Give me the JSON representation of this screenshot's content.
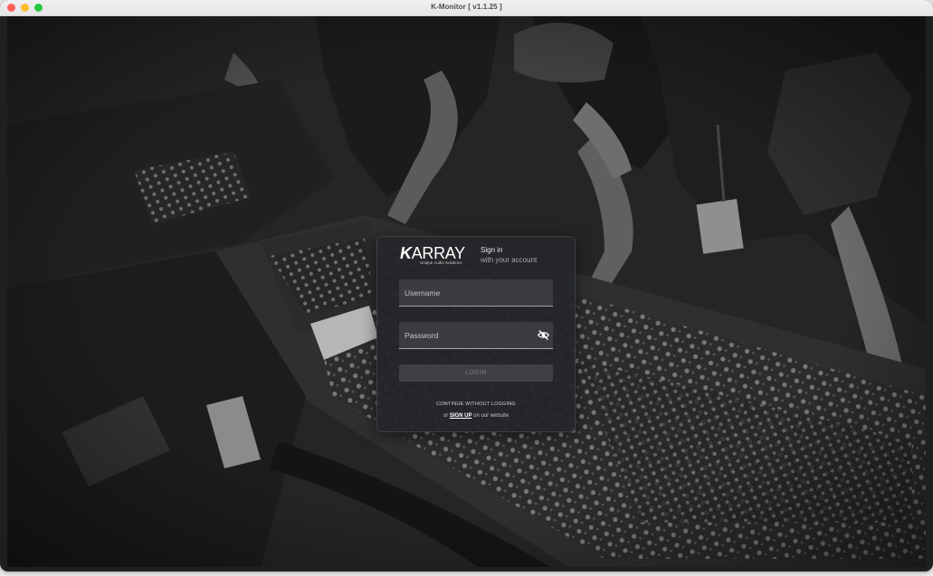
{
  "window": {
    "title": "K-Monitor [ v1.1.25 ]"
  },
  "login": {
    "logo_text": "ARRAY",
    "logo_mark": "K",
    "logo_tagline": "Unique Audio Solutions",
    "title": "Sign in",
    "subtitle": "with your account",
    "username_placeholder": "Username",
    "password_placeholder": "Password",
    "password_toggle_icon": "eye-off-icon",
    "login_label": "LOGIN",
    "continue_label": "CONTINUE WITHOUT LOGGING",
    "signup_prefix": "or",
    "signup_link": "SIGN UP",
    "signup_suffix": "on our website"
  },
  "colors": {
    "panel_bg": "#25272a",
    "field_bg": "#3a3c3f",
    "button_bg": "#3e4043",
    "button_text": "#7c7e81"
  }
}
